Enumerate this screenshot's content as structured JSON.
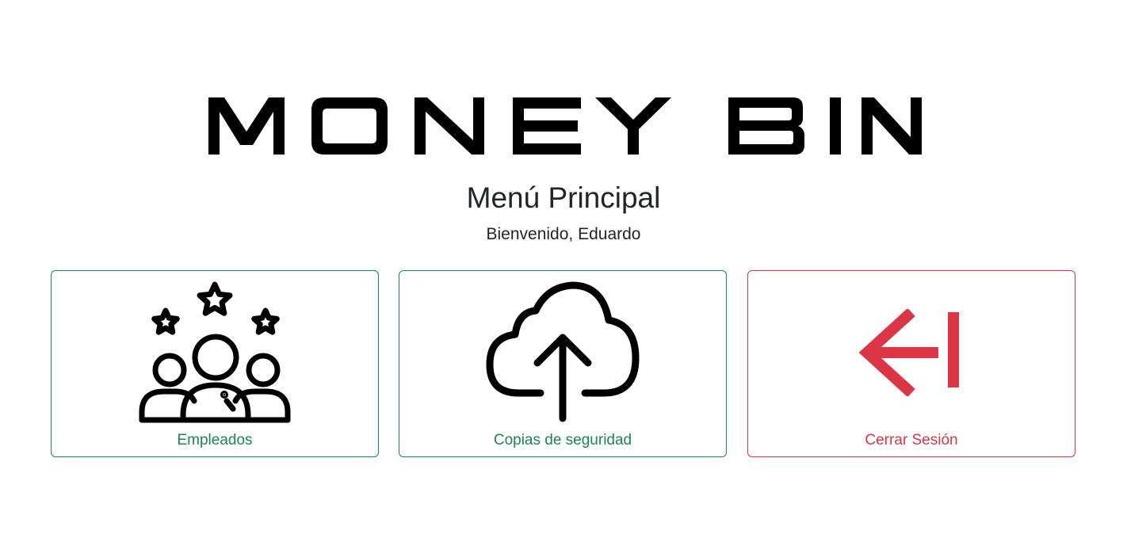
{
  "logo": {
    "text": "MONEY BIN"
  },
  "header": {
    "title": "Menú Principal",
    "welcome": "Bienvenido, Eduardo"
  },
  "menu": [
    {
      "label": "Empleados",
      "icon": "team-stars-icon",
      "color": "#198754"
    },
    {
      "label": "Copias de seguridad",
      "icon": "cloud-upload-icon",
      "color": "#198754"
    },
    {
      "label": "Cerrar Sesión",
      "icon": "logout-arrow-icon",
      "color": "#dc3545"
    }
  ],
  "colors": {
    "success": "#198754",
    "danger": "#dc3545",
    "text": "#212529"
  }
}
